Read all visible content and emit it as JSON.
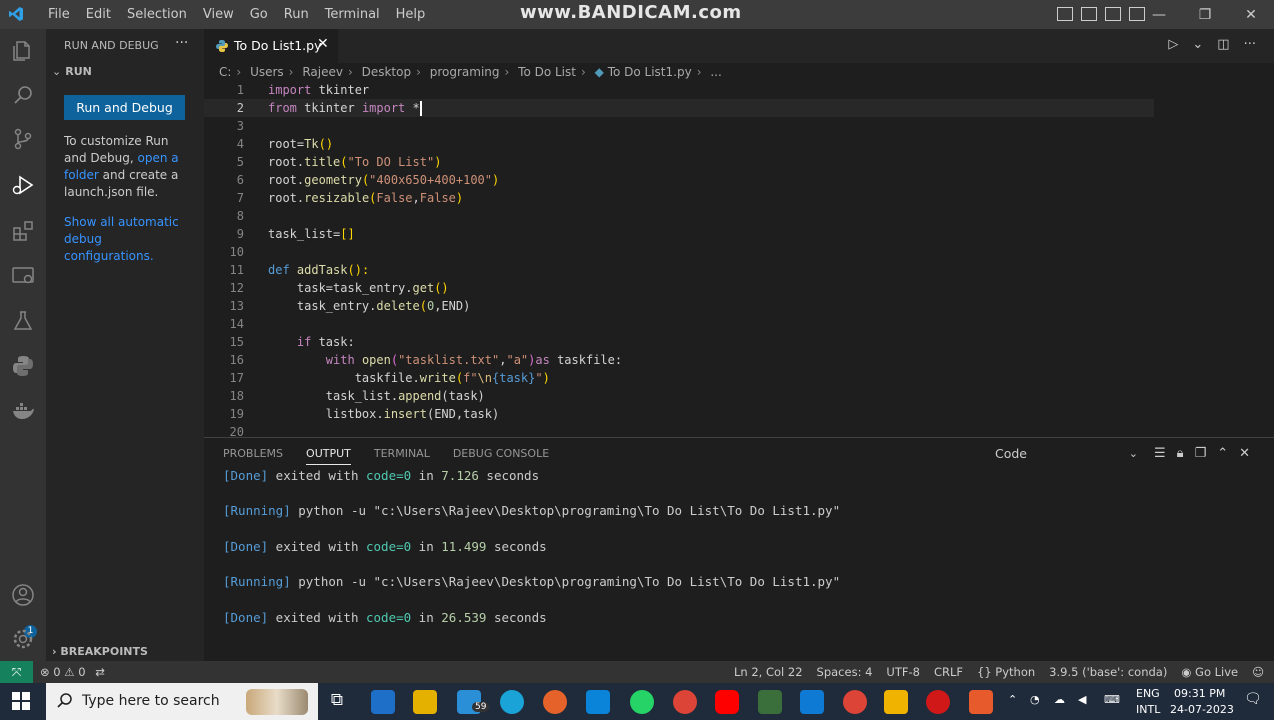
{
  "titlebar": {
    "menu": [
      "File",
      "Edit",
      "Selection",
      "View",
      "Go",
      "Run",
      "Terminal",
      "Help"
    ],
    "watermark": "www.BANDICAM.com"
  },
  "activity_icons": [
    "explorer-icon",
    "search-icon",
    "source-control-icon",
    "run-debug-icon",
    "extensions-icon",
    "remote-explorer-icon",
    "testing-icon",
    "python-icon",
    "docker-icon",
    "accounts-icon",
    "settings-gear-icon"
  ],
  "accounts_badge": "1",
  "sidebar": {
    "title": "RUN AND DEBUG",
    "section": "RUN",
    "run_button": "Run and Debug",
    "text_before": "To customize Run and Debug,",
    "text_link": "open a folder",
    "text_after": "and create a launch.json file.",
    "show_all_link": "Show all automatic debug configurations.",
    "breakpoints": "BREAKPOINTS"
  },
  "tab": {
    "label": "To Do List1.py"
  },
  "breadcrumb": [
    "C:",
    "Users",
    "Rajeev",
    "Desktop",
    "programing",
    "To Do List",
    "To Do List1.py",
    "..."
  ],
  "editor": {
    "lines": [
      {
        "n": "1"
      },
      {
        "n": "2"
      },
      {
        "n": "3"
      },
      {
        "n": "4"
      },
      {
        "n": "5"
      },
      {
        "n": "6"
      },
      {
        "n": "7"
      },
      {
        "n": "8"
      },
      {
        "n": "9"
      },
      {
        "n": "10"
      },
      {
        "n": "11"
      },
      {
        "n": "12"
      },
      {
        "n": "13"
      },
      {
        "n": "14"
      },
      {
        "n": "15"
      },
      {
        "n": "16"
      },
      {
        "n": "17"
      },
      {
        "n": "18"
      },
      {
        "n": "19"
      },
      {
        "n": "20"
      }
    ],
    "code": {
      "l1": [
        "import",
        " tkinter"
      ],
      "l2": [
        "from",
        " tkinter ",
        "import",
        " *"
      ],
      "l4": [
        "root",
        "=",
        "Tk",
        "()"
      ],
      "l5": [
        "root",
        ".",
        "title",
        "(",
        "\"To DO List\"",
        ")"
      ],
      "l6": [
        "root",
        ".",
        "geometry",
        "(",
        "\"400x650+400+100\"",
        ")"
      ],
      "l7": [
        "root",
        ".",
        "resizable",
        "(",
        "False",
        ",",
        "False",
        ")"
      ],
      "l9": [
        "task_list",
        "=",
        "[]"
      ],
      "l11": [
        "def",
        " ",
        "addTask",
        "():"
      ],
      "l12": [
        "    task",
        "=",
        "task_entry",
        ".",
        "get",
        "()"
      ],
      "l13": [
        "    task_entry",
        ".",
        "delete",
        "(",
        "0",
        ",END)"
      ],
      "l15": [
        "    ",
        "if",
        " task:"
      ],
      "l16": [
        "        ",
        "with",
        " ",
        "open",
        "(",
        "\"tasklist.txt\"",
        ",",
        "\"a\"",
        ")",
        "as",
        " taskfile:"
      ],
      "l17": [
        "            taskfile",
        ".",
        "write",
        "(",
        "f\"",
        "\\n",
        "{task}",
        "\"",
        ")"
      ],
      "l18": [
        "        task_list",
        ".",
        "append",
        "(task)"
      ],
      "l19": [
        "        listbox",
        ".",
        "insert",
        "(END,task)"
      ]
    }
  },
  "panel": {
    "tabs": [
      "PROBLEMS",
      "OUTPUT",
      "TERMINAL",
      "DEBUG CONSOLE"
    ],
    "active_tab": "OUTPUT",
    "select_value": "Code",
    "output": [
      {
        "tag": "[Done]",
        "pre": " exited with ",
        "code": "code=0",
        "mid": " in ",
        "num": "7.126",
        "post": " seconds"
      },
      {
        "tag": "[Running]",
        "text": " python -u \"c:\\Users\\Rajeev\\Desktop\\programing\\To Do List\\To Do List1.py\""
      },
      {
        "tag": "[Done]",
        "pre": " exited with ",
        "code": "code=0",
        "mid": " in ",
        "num": "11.499",
        "post": " seconds"
      },
      {
        "tag": "[Running]",
        "text": " python -u \"c:\\Users\\Rajeev\\Desktop\\programing\\To Do List\\To Do List1.py\""
      },
      {
        "tag": "[Done]",
        "pre": " exited with ",
        "code": "code=0",
        "mid": " in ",
        "num": "26.539",
        "post": " seconds"
      }
    ]
  },
  "statusbar": {
    "errors": "0",
    "warnings": "0",
    "position": "Ln 2, Col 22",
    "spaces": "Spaces: 4",
    "encoding": "UTF-8",
    "eol": "CRLF",
    "language": "Python",
    "interpreter": "3.9.5 ('base': conda)",
    "golive": "Go Live"
  },
  "taskbar": {
    "search_placeholder": "Type here to search",
    "weather_badge": "59",
    "lang1": "ENG",
    "lang2": "INTL",
    "time": "09:31 PM",
    "date": "24-07-2023"
  },
  "colors": {
    "accent": "#0e639c",
    "keyword": "#c586c0",
    "function": "#dcdcaa",
    "string": "#ce9178"
  }
}
